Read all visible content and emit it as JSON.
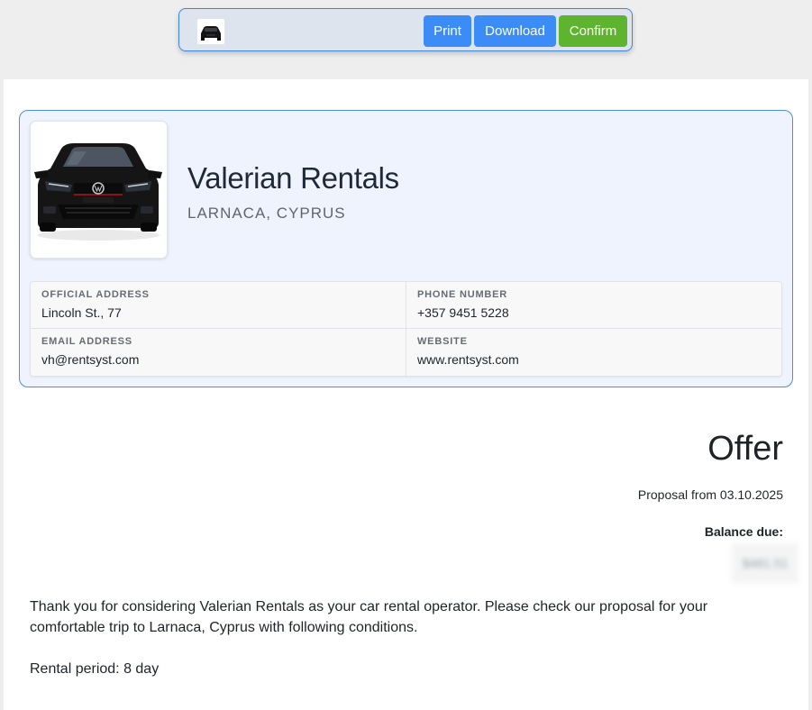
{
  "toolbar": {
    "thumbnail_alt": "car thumbnail",
    "print_label": "Print",
    "download_label": "Download",
    "confirm_label": "Confirm",
    "colors": {
      "primary": "#3b8cf6",
      "confirm": "#5eb42e",
      "border": "#3d86e8"
    }
  },
  "company": {
    "name": "Valerian Rentals",
    "location": "LARNACA, CYPRUS",
    "logo_icon": "car-photo",
    "info": [
      {
        "label": "OFFICIAL ADDRESS",
        "value": "Lincoln St., 77"
      },
      {
        "label": "PHONE NUMBER",
        "value": "+357 9451 5228"
      },
      {
        "label": "EMAIL ADDRESS",
        "value": "vh@rentsyst.com"
      },
      {
        "label": "WEBSITE",
        "value": "www.rentsyst.com"
      }
    ],
    "colors": {
      "card_background": "#eef3fd",
      "card_border": "#4b8fdc"
    }
  },
  "offer": {
    "title": "Offer",
    "proposal": "Proposal from 03.10.2025",
    "balance_label": "Balance due:",
    "balance_value": "$481.51"
  },
  "body": {
    "intro": "Thank you for considering Valerian Rentals as your car rental operator. Please check our proposal for your comfortable trip to Larnaca, Cyprus with following conditions.",
    "rental_period": "Rental period: 8 day"
  }
}
